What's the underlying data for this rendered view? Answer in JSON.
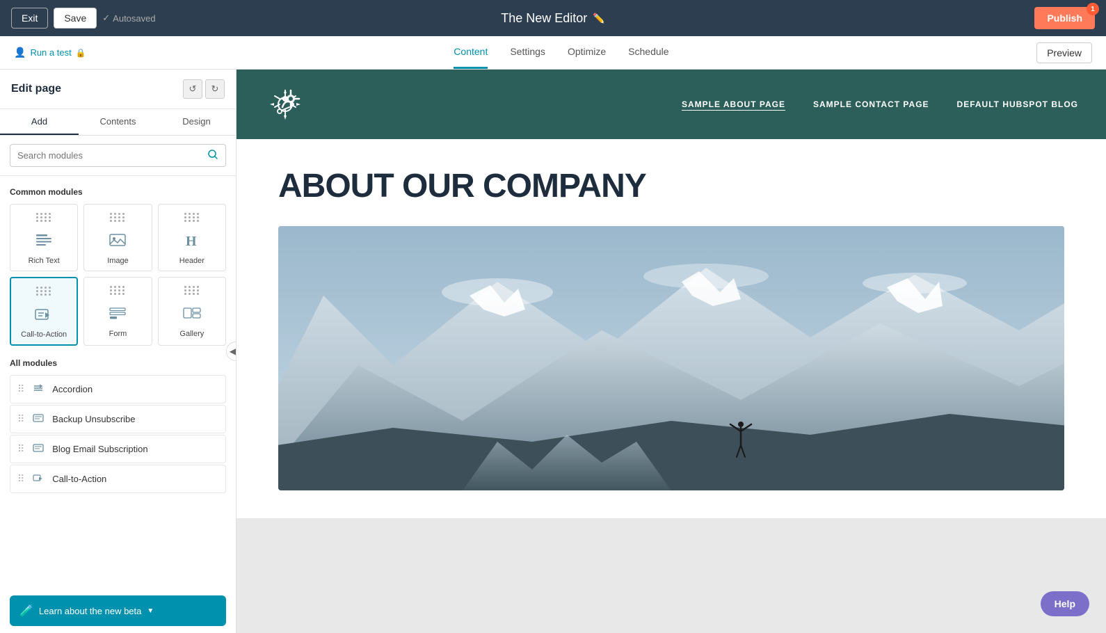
{
  "topbar": {
    "exit_label": "Exit",
    "save_label": "Save",
    "autosaved_label": "Autosaved",
    "page_title": "The New Editor",
    "publish_label": "Publish",
    "publish_badge": "1"
  },
  "subnav": {
    "run_test_label": "Run a test",
    "tabs": [
      {
        "id": "content",
        "label": "Content",
        "active": true
      },
      {
        "id": "settings",
        "label": "Settings",
        "active": false
      },
      {
        "id": "optimize",
        "label": "Optimize",
        "active": false
      },
      {
        "id": "schedule",
        "label": "Schedule",
        "active": false
      }
    ],
    "preview_label": "Preview"
  },
  "sidebar": {
    "title": "Edit page",
    "undo_label": "↺",
    "redo_label": "↻",
    "tabs": [
      {
        "id": "add",
        "label": "Add",
        "active": true
      },
      {
        "id": "contents",
        "label": "Contents",
        "active": false
      },
      {
        "id": "design",
        "label": "Design",
        "active": false
      }
    ],
    "search_placeholder": "Search modules",
    "common_modules_label": "Common modules",
    "common_modules": [
      {
        "id": "rich-text",
        "label": "Rich Text",
        "icon": "text"
      },
      {
        "id": "image",
        "label": "Image",
        "icon": "image"
      },
      {
        "id": "header",
        "label": "Header",
        "icon": "header"
      },
      {
        "id": "call-to-action",
        "label": "Call-to-Action",
        "icon": "cta"
      },
      {
        "id": "form",
        "label": "Form",
        "icon": "form"
      },
      {
        "id": "gallery",
        "label": "Gallery",
        "icon": "gallery"
      }
    ],
    "all_modules_label": "All modules",
    "all_modules": [
      {
        "id": "accordion",
        "label": "Accordion",
        "icon": "x"
      },
      {
        "id": "backup-unsubscribe",
        "label": "Backup Unsubscribe",
        "icon": "list"
      },
      {
        "id": "blog-email-subscription",
        "label": "Blog Email Subscription",
        "icon": "list"
      },
      {
        "id": "call-to-action",
        "label": "Call-to-Action",
        "icon": "cta-small"
      }
    ],
    "beta_label": "Learn about the new beta",
    "beta_arrow": "▼"
  },
  "canvas": {
    "nav_items": [
      {
        "id": "about",
        "label": "SAMPLE ABOUT PAGE",
        "active": true
      },
      {
        "id": "contact",
        "label": "SAMPLE CONTACT PAGE",
        "active": false
      },
      {
        "id": "blog",
        "label": "DEFAULT HUBSPOT BLOG",
        "active": false
      }
    ],
    "page_heading": "ABOUT OUR COMPANY"
  },
  "help": {
    "label": "Help"
  }
}
